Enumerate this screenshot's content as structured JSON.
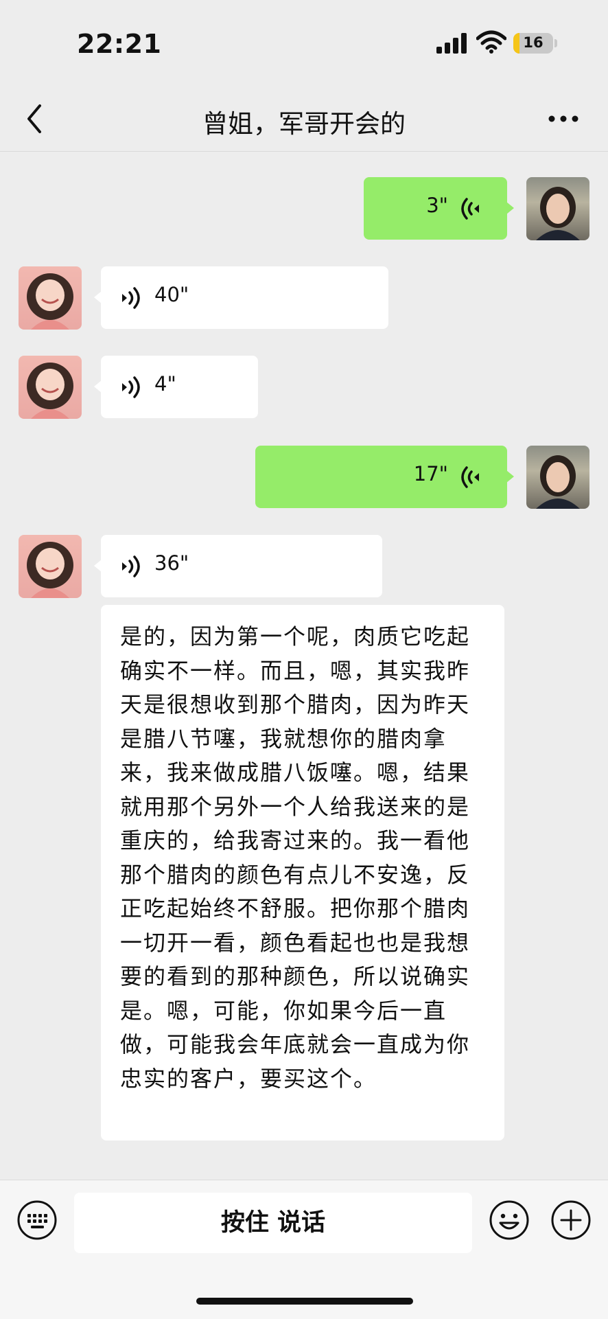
{
  "status_bar": {
    "time": "22:21",
    "battery_level": "16",
    "battery_fraction": 0.16,
    "icons": [
      "signal-icon",
      "wifi-icon",
      "battery-icon"
    ]
  },
  "header": {
    "title": "曾姐，军哥开会的",
    "back_icon": "chevron-left-icon",
    "more_icon": "more-dots-icon"
  },
  "messages": [
    {
      "sender": "me",
      "type": "voice",
      "duration": "3\""
    },
    {
      "sender": "other",
      "type": "voice",
      "duration": "40\""
    },
    {
      "sender": "other",
      "type": "voice",
      "duration": "4\""
    },
    {
      "sender": "me",
      "type": "voice",
      "duration": "17\""
    },
    {
      "sender": "other",
      "type": "voice",
      "duration": "36\""
    }
  ],
  "transcript": {
    "text": "是的，因为第一个呢，肉质它吃起确实不一样。而且，嗯，其实我昨天是很想收到那个腊肉，因为昨天是腊八节噻，我就想你的腊肉拿来，我来做成腊八饭噻。嗯，结果就用那个另外一个人给我送来的是重庆的，给我寄过来的。我一看他那个腊肉的颜色有点儿不安逸，反正吃起始终不舒服。把你那个腊肉一切开一看，颜色看起也也是我想要的看到的那种颜色，所以说确实是。嗯，可能，你如果今后一直做，可能我会年底就会一直成为你忠实的客户，要买这个。"
  },
  "input_bar": {
    "hold_to_talk_label": "按住 说话",
    "keyboard_icon": "keyboard-icon",
    "emoji_icon": "emoji-icon",
    "plus_icon": "plus-icon"
  },
  "colors": {
    "background": "#ededed",
    "my_bubble": "#95ec69",
    "other_bubble": "#ffffff",
    "battery_fill": "#f5c518"
  }
}
